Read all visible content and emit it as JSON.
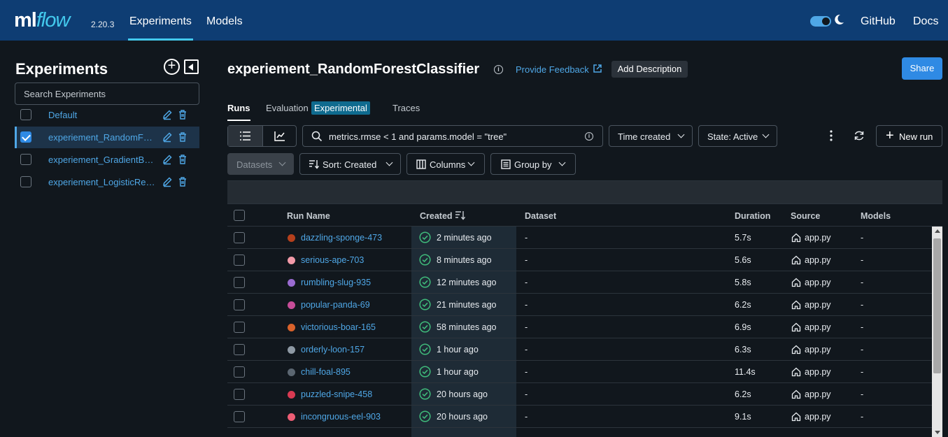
{
  "topbar": {
    "logo_ml": "ml",
    "logo_flow": "flow",
    "version": "2.20.3",
    "nav": [
      "Experiments",
      "Models"
    ],
    "right_links": [
      "GitHub",
      "Docs"
    ],
    "theme_icon": "moon-icon"
  },
  "sidebar": {
    "title": "Experiments",
    "search_placeholder": "Search Experiments",
    "items": [
      {
        "label": "Default",
        "checked": false
      },
      {
        "label": "experiement_RandomForestClassifier",
        "checked": true
      },
      {
        "label": "experiement_GradientBoostingClassifier",
        "checked": false
      },
      {
        "label": "experiement_LogisticRegression",
        "checked": false
      }
    ]
  },
  "header": {
    "title": "experiement_RandomForestClassifier",
    "feedback": "Provide Feedback",
    "add_description": "Add Description",
    "share": "Share"
  },
  "tabs": {
    "runs": "Runs",
    "evaluation": "Evaluation",
    "experimental_badge": "Experimental",
    "traces": "Traces"
  },
  "toolbar": {
    "search_value": "metrics.rmse < 1 and params.model = \"tree\"",
    "time_created": "Time created",
    "state": "State: Active",
    "new_run": "New run",
    "datasets": "Datasets",
    "sort": "Sort: Created",
    "columns": "Columns",
    "group_by": "Group by"
  },
  "table": {
    "columns": [
      "Run Name",
      "Created",
      "Dataset",
      "Duration",
      "Source",
      "Models"
    ],
    "rows": [
      {
        "name": "dazzling-sponge-473",
        "color": "#b5401c",
        "created": "2 minutes ago",
        "dataset": "-",
        "duration": "5.7s",
        "source": "app.py",
        "models": "-"
      },
      {
        "name": "serious-ape-703",
        "color": "#f29aa8",
        "created": "8 minutes ago",
        "dataset": "-",
        "duration": "5.6s",
        "source": "app.py",
        "models": "-"
      },
      {
        "name": "rumbling-slug-935",
        "color": "#9a6bd1",
        "created": "12 minutes ago",
        "dataset": "-",
        "duration": "5.8s",
        "source": "app.py",
        "models": "-"
      },
      {
        "name": "popular-panda-69",
        "color": "#c74d98",
        "created": "21 minutes ago",
        "dataset": "-",
        "duration": "6.2s",
        "source": "app.py",
        "models": "-"
      },
      {
        "name": "victorious-boar-165",
        "color": "#d9622b",
        "created": "58 minutes ago",
        "dataset": "-",
        "duration": "6.9s",
        "source": "app.py",
        "models": "-"
      },
      {
        "name": "orderly-loon-157",
        "color": "#8e99a4",
        "created": "1 hour ago",
        "dataset": "-",
        "duration": "6.3s",
        "source": "app.py",
        "models": "-"
      },
      {
        "name": "chill-foal-895",
        "color": "#5b6671",
        "created": "1 hour ago",
        "dataset": "-",
        "duration": "11.4s",
        "source": "app.py",
        "models": "-"
      },
      {
        "name": "puzzled-snipe-458",
        "color": "#d93a52",
        "created": "20 hours ago",
        "dataset": "-",
        "duration": "6.2s",
        "source": "app.py",
        "models": "-"
      },
      {
        "name": "incongruous-eel-903",
        "color": "#ec5d74",
        "created": "20 hours ago",
        "dataset": "-",
        "duration": "9.1s",
        "source": "app.py",
        "models": "-"
      }
    ]
  },
  "colors": {
    "topbar": "#0e3d73",
    "background": "#11171d",
    "link": "#4fa7e6",
    "primary": "#2f8ae4",
    "success": "#3fba7a"
  }
}
